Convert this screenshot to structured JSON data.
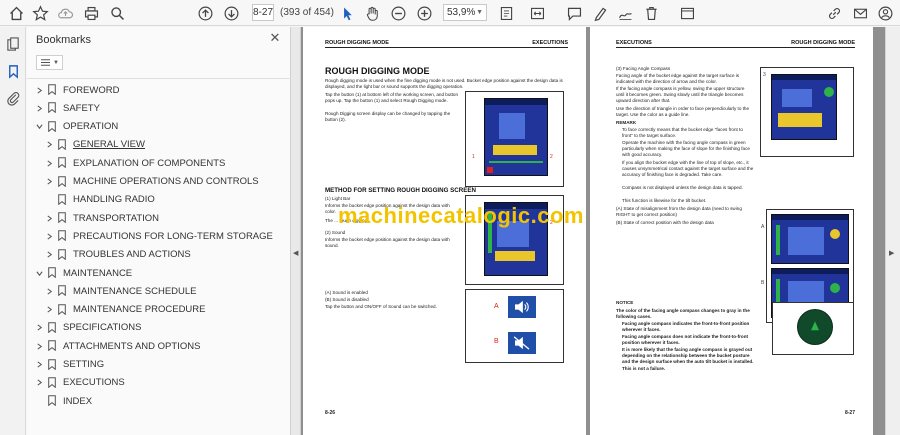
{
  "toolbar": {
    "page_current": "8-27",
    "page_count": "(393 of 454)",
    "zoom": "53,9%",
    "icons": [
      "home-icon",
      "star-icon",
      "cloud-upload-icon",
      "print-icon",
      "zoom-search-icon",
      "previous-page-icon",
      "next-page-icon",
      "select-cursor-icon",
      "hand-icon",
      "zoom-out-icon",
      "zoom-in-icon",
      "fit-page-icon",
      "comment-icon",
      "highlight-pen-icon",
      "sign-icon",
      "delete-icon",
      "read-mode-icon",
      "link-icon",
      "email-icon",
      "account-icon"
    ]
  },
  "sidebar": {
    "title": "Bookmarks",
    "items": [
      {
        "label": "FOREWORD",
        "level": 0,
        "expand": "collapsed"
      },
      {
        "label": "SAFETY",
        "level": 0,
        "expand": "collapsed"
      },
      {
        "label": "OPERATION",
        "level": 0,
        "expand": "expanded"
      },
      {
        "label": "GENERAL VIEW",
        "level": 1,
        "expand": "collapsed",
        "selected": true
      },
      {
        "label": "EXPLANATION OF COMPONENTS",
        "level": 1,
        "expand": "collapsed"
      },
      {
        "label": "MACHINE OPERATIONS AND CONTROLS",
        "level": 1,
        "expand": "collapsed"
      },
      {
        "label": "HANDLING RADIO",
        "level": 1,
        "expand": "none"
      },
      {
        "label": "TRANSPORTATION",
        "level": 1,
        "expand": "collapsed"
      },
      {
        "label": "PRECAUTIONS FOR LONG-TERM STORAGE",
        "level": 1,
        "expand": "collapsed"
      },
      {
        "label": "TROUBLES AND ACTIONS",
        "level": 1,
        "expand": "collapsed"
      },
      {
        "label": "MAINTENANCE",
        "level": 0,
        "expand": "expanded"
      },
      {
        "label": "MAINTENANCE SCHEDULE",
        "level": 1,
        "expand": "collapsed"
      },
      {
        "label": "MAINTENANCE PROCEDURE",
        "level": 1,
        "expand": "collapsed"
      },
      {
        "label": "SPECIFICATIONS",
        "level": 0,
        "expand": "collapsed"
      },
      {
        "label": "ATTACHMENTS AND OPTIONS",
        "level": 0,
        "expand": "collapsed"
      },
      {
        "label": "SETTING",
        "level": 0,
        "expand": "collapsed"
      },
      {
        "label": "EXECUTIONS",
        "level": 0,
        "expand": "collapsed"
      },
      {
        "label": "INDEX",
        "level": 0,
        "expand": "none"
      }
    ]
  },
  "left_page": {
    "header_left": "ROUGH DIGGING MODE",
    "header_right": "EXECUTIONS",
    "title": "ROUGH DIGGING MODE",
    "intro": "Rough digging mode is used when the fine digging mode is not used. Bucket edge position against the design data is displayed, and the light bar or sound supports the digging operation.",
    "step1": "Tap the button (1) at bottom left of the working screen, and button pops up. Tap the button (1) and select Rough Digging mode.",
    "step2": "Rough Digging screen display can be changed by tapping the button (2).",
    "method_title": "METHOD FOR SETTING ROUGH DIGGING SCREEN",
    "light_bar_title": "(1) Light Bar",
    "light_bar_text": "Informs the bucket edge position against the design data with color.",
    "light_bar_note": "The ... rough digging",
    "sound_title": "(2) Sound",
    "sound_text": "Informs the bucket edge position against the design data with sound.",
    "sound_enabled": "(A) Sound is enabled",
    "sound_disabled": "(B) Sound is disabled",
    "sound_toggle": "Tap the button and ON/OFF of Sound can be switched.",
    "label_a": "A",
    "label_b": "B",
    "label_1": "1",
    "label_2": "2",
    "footer": "8-26"
  },
  "right_page": {
    "header_left": "EXECUTIONS",
    "header_right": "ROUGH DIGGING MODE",
    "facing_title": "(3) Facing Angle Compass",
    "facing_text": "Facing angle of the bucket edge against the target surface is indicated with the direction of arrow and the color.",
    "facing_text2": "If the facing angle compass is yellow, swing the upper structure until it becomes green. Swing slowly until the triangle becomes upward direction after that.",
    "facing_text3": "Use the direction of triangle in order to face perpendicularly to the target. Use the color as a guide line.",
    "remark": "REMARK",
    "remark_b1": "To face correctly means that the bucket edge \"faces front to front\" to the target surface.",
    "remark_b2": "Operate the machine with the facing angle compass in green particularly when making the face of slope for the finishing face with good accuracy.",
    "remark_b3": "If you align the bucket edge with the line of top of slope, etc., it causes unsymmetrical contact against the target surface and the accuracy of finishing face is degraded. Take care.",
    "remark_b4": "Compass is not displayed unless the design data is tapped.",
    "remark_b5": "This function is likewise for the tilt bucket.",
    "state_a": "(A) State of misalignment from the design data (need to swing RIGHT to get correct position)",
    "state_b": "(B) State of correct position with the design data",
    "notice": "NOTICE",
    "notice_text": "The color of the facing angle compass changes to gray in the following cases.",
    "notice_b1": "Facing angle compass indicates the front-to-front position wherever it faces.",
    "notice_b2": "Facing angle compass does not indicate the front-to-front position wherever it faces.",
    "notice_b3": "It is more likely that the facing angle compass is grayed out depending on the relationship between the bucket posture and the design surface when the auto tilt bucket is installed. This is not a failure.",
    "label_3": "3",
    "label_a": "A",
    "label_b": "B",
    "footer": "8-27"
  },
  "watermark": "machinecatalogic.com",
  "colors": {
    "accent_blue": "#1f5fbf",
    "screen_blue": "#20349a",
    "watermark_yellow": "#f2c400",
    "label_red": "#e0201e",
    "viewer_gray": "#8f8f8f"
  }
}
